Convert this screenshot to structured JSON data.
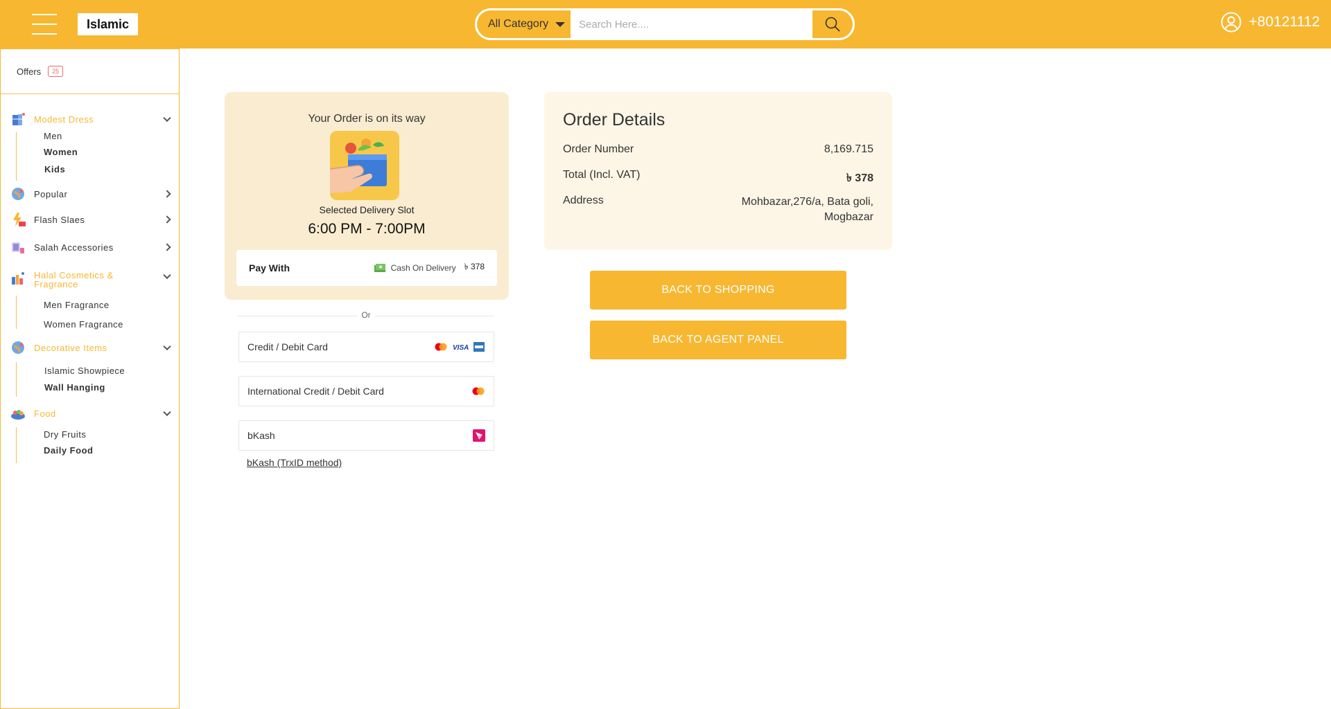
{
  "header": {
    "brand": "Islamic",
    "category": "All Category",
    "search_placeholder": "Search Here....",
    "phone": "+80121112",
    "accent": "#f7b731"
  },
  "sidebar": {
    "offers_label": "Offers",
    "offers_count": "25",
    "categories": [
      {
        "label": "Modest Dress",
        "icon": "dress-icon",
        "sub": [
          "Men",
          "Women",
          "Kids"
        ]
      },
      {
        "label": "Popular",
        "icon": "globe-icon"
      },
      {
        "label": "Flash Slaes",
        "icon": "flash-sale-icon"
      },
      {
        "label": "Salah Accessories",
        "icon": "salah-icon"
      },
      {
        "label": "Halal Cosmetics & Fragrance",
        "icon": "cosmetics-icon",
        "sub": [
          "Men Fragrance",
          "Women Fragrance"
        ]
      },
      {
        "label": "Decorative Items",
        "icon": "decor-icon",
        "sub": [
          "Islamic Showpiece",
          "Wall Hanging"
        ]
      },
      {
        "label": "Food",
        "icon": "food-icon",
        "sub": [
          "Dry Fruits",
          "Daily Food"
        ]
      }
    ]
  },
  "order_status": {
    "title": "Your Order is on its way",
    "slot_label": "Selected Delivery Slot",
    "slot": "6:00 PM - 7:00PM",
    "pay_with": "Pay With",
    "method": "Cash On Delivery",
    "amount": "৳ 378"
  },
  "payment": {
    "or": "Or",
    "options": [
      "Credit / Debit Card",
      "International Credit / Debit Card",
      "bKash"
    ],
    "link": "bKash (TrxID method)"
  },
  "details": {
    "title": "Order Details",
    "rows": [
      {
        "label": "Order Number",
        "value": "8,169.715"
      },
      {
        "label": "Total (Incl. VAT)",
        "value": "৳ 378"
      },
      {
        "label": "Address",
        "value": "Mohbazar,276/a, Bata goli,",
        "value2": "Mogbazar"
      }
    ]
  },
  "buttons": {
    "shopping": "BACK TO SHOPPING",
    "agent": "BACK TO AGENT PANEL"
  }
}
